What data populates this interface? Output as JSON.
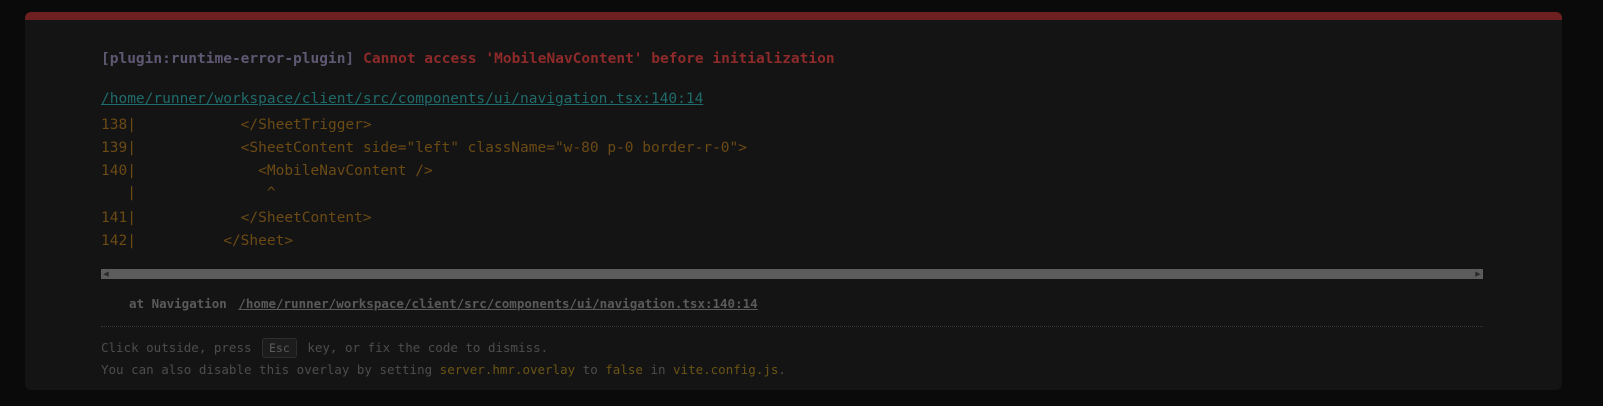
{
  "overlay": {
    "plugin": "[plugin:runtime-error-plugin]",
    "message": "Cannot access 'MobileNavContent' before initialization",
    "file": "/home/runner/workspace/client/src/components/ui/navigation.tsx:140:14",
    "frame": [
      "138|            </SheetTrigger>",
      "139|            <SheetContent side=\"left\" className=\"w-80 p-0 border-r-0\">",
      "140|              <MobileNavContent />",
      "   |               ^",
      "141|            </SheetContent>",
      "142|          </Sheet>"
    ],
    "scroll_left": "◀",
    "scroll_right": "▶",
    "stack_prefix": "at Navigation",
    "stack_file": "/home/runner/workspace/client/src/components/ui/navigation.tsx:140:14",
    "tip": {
      "part1": "Click outside, press",
      "key": "Esc",
      "part2": "key, or fix the code to dismiss.",
      "line2_part1": "You can also disable this overlay by setting",
      "setting": "server.hmr.overlay",
      "line2_part2": "to",
      "value": "false",
      "line2_part3": "in",
      "config": "vite.config.js",
      "line2_part4": "."
    }
  },
  "colors": {
    "border_top": "#6e1f1f",
    "plugin": "#5f5873",
    "message": "#8e2a2a",
    "file_link": "#1f6b6b",
    "code": "#6b4a14"
  }
}
